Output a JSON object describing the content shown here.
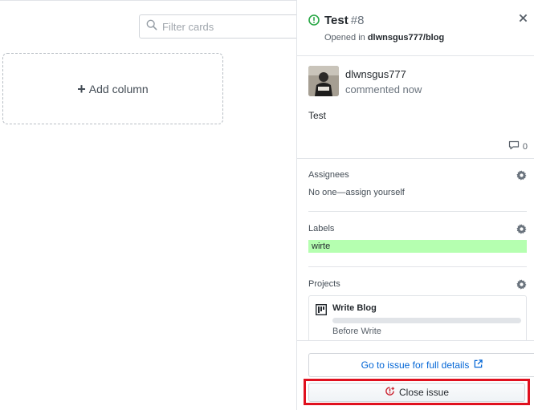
{
  "board": {
    "filter_placeholder": "Filter cards",
    "add_column_label": "Add column"
  },
  "issue": {
    "title": "Test",
    "number": "#8",
    "opened_prefix": "Opened in",
    "repository": "dlwnsgus777/blog",
    "state_icon": "issue-opened-icon",
    "accent_color": "#28a745"
  },
  "comment": {
    "author": "dlwnsgus777",
    "time": "commented now",
    "body": "Test",
    "count": "0"
  },
  "assignees": {
    "title": "Assignees",
    "value": "No one—assign yourself"
  },
  "labels": {
    "title": "Labels",
    "items": [
      {
        "name": "wirte",
        "color": "#b5ffb0"
      }
    ]
  },
  "projects": {
    "title": "Projects",
    "items": [
      {
        "name": "Write Blog",
        "column": "Before Write",
        "progress": 0
      }
    ]
  },
  "actions": {
    "go_to_issue": "Go to issue for full details",
    "close_issue": "Close issue",
    "highlight_color": "#e0101e"
  }
}
